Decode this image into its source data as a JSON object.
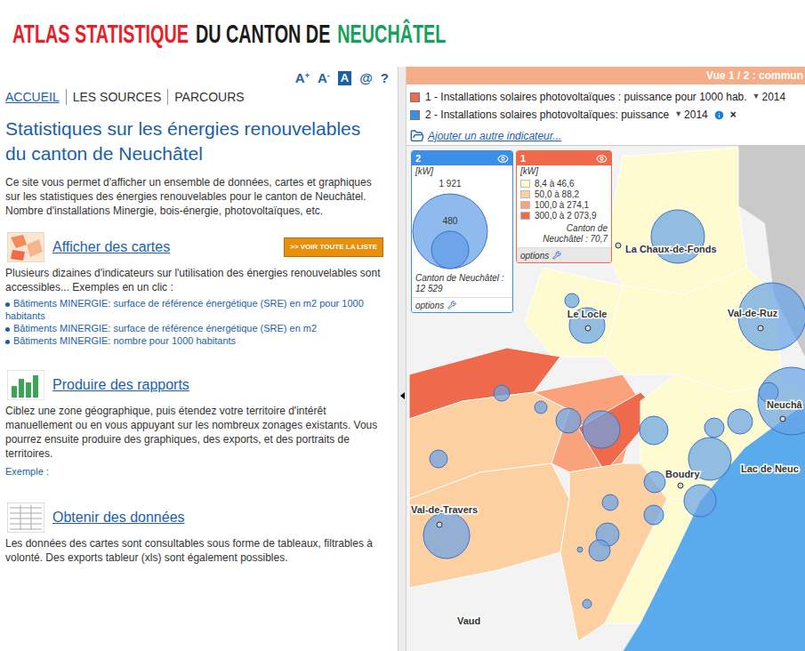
{
  "title": [
    {
      "text": "ATLAS STATISTIQUE",
      "color": "#e8202a"
    },
    {
      "text": "DU CANTON DE",
      "color": "#1a1a1a"
    },
    {
      "text": "NEUCHÂTEL",
      "color": "#16a05d"
    }
  ],
  "toolbar": [
    {
      "label": "A",
      "sup": "+",
      "kind": "plain"
    },
    {
      "label": "A",
      "sup": "-",
      "kind": "plain"
    },
    {
      "label": "A",
      "sup": "",
      "kind": "boxed"
    },
    {
      "label": "@",
      "sup": "",
      "kind": "plain"
    },
    {
      "label": "?",
      "sup": "",
      "kind": "plain"
    }
  ],
  "nav": [
    {
      "label": "ACCUEIL",
      "selected": true
    },
    {
      "label": "LES SOURCES",
      "selected": false
    },
    {
      "label": "PARCOURS",
      "selected": false
    }
  ],
  "heading": "Statistiques sur les énergies renouvelables du canton de Neuchâtel",
  "intro": "Ce site vous permet d'afficher un ensemble de données, cartes et graphiques sur les statistiques des énergies renouvelables pour le canton de Neuchâtel. Nombre d'installations Minergie, bois-énergie, photovoltaïques, etc.",
  "sections": [
    {
      "kind": "maps",
      "title": "Afficher des cartes",
      "button": ">> VOIR TOUTE LA LISTE",
      "text": "Plusieurs dizaines d'indicateurs sur l'utilisation des énergies renouvelables sont accessibles... Exemples en un clic :",
      "links": [
        "Bâtiments MINERGIE: surface de référence énergétique (SRE) en m2 pour 1000 habitants",
        "Bâtiments MINERGIE: surface de référence énergétique (SRE) en m2",
        "Bâtiments MINERGIE: nombre pour 1000 habitants"
      ]
    },
    {
      "kind": "reports",
      "title": "Produire des rapports",
      "text": "Ciblez une zone géographique, puis étendez votre territoire d'intérêt manuellement ou en vous appuyant sur les nombreux zonages existants. Vous pourrez ensuite produire des graphiques, des exports, et des portraits de territoires.",
      "example": "Exemple :"
    },
    {
      "kind": "data",
      "title": "Obtenir des données",
      "text": "Les données des cartes sont consultables sous forme de tableaux, filtrables à volonté. Des exports tableur (xls) sont également possibles."
    }
  ],
  "map": {
    "view": "Vue 1 / 2 : commun",
    "indicators": [
      {
        "label": "1 - Installations solaires photovoltaïques : puissance pour 1000 hab.",
        "arrow": "▼",
        "year": "2014",
        "color": "#ef6a4a",
        "info": false
      },
      {
        "label": "2 - Installations solaires photovoltaïques: puissance",
        "arrow": "▼",
        "year": "2014",
        "color": "#3b8fe6",
        "info": true,
        "close": "×"
      }
    ],
    "add_indicator": "Ajouter un autre indicateur...",
    "legend_circles": {
      "number": "2",
      "unit": "[kW]",
      "big": "1 921",
      "small": "480",
      "total_label": "Canton de Neuchâtel :",
      "total": "12 529",
      "options": "options",
      "color": "#3b8fe6"
    },
    "legend_classes": {
      "number": "1",
      "unit": "[kW]",
      "classes": [
        {
          "label": "8,4 à 46,6",
          "color": "#fffbd0"
        },
        {
          "label": "50,0 à 88,2",
          "color": "#fdd0a2"
        },
        {
          "label": "100,0 à 274,1",
          "color": "#f9a27c"
        },
        {
          "label": "300,0 à 2 073,9",
          "color": "#ef6a4a"
        }
      ],
      "total_label": "Canton de",
      "total": "Neuchâtel : 70,7",
      "options": "options",
      "color": "#ef6a4a"
    },
    "regions": [
      {
        "class": 0
      },
      {
        "class": 0
      },
      {
        "class": 0
      },
      {
        "class": 3
      },
      {
        "class": 1
      },
      {
        "class": 2
      },
      {
        "class": 3
      },
      {
        "class": 0
      },
      {
        "class": 1
      },
      {
        "class": 1
      },
      {
        "class": 0
      }
    ],
    "bubbles": [
      {
        "level": 0.75
      },
      {
        "level": 0.5
      },
      {
        "level": 0.95
      },
      {
        "level": 0.95
      },
      {
        "level": 0.2
      },
      {
        "level": 0.225
      },
      {
        "level": 0.175
      },
      {
        "level": 0.35
      },
      {
        "level": 0.525
      },
      {
        "level": 0.4
      },
      {
        "level": 0.275
      },
      {
        "level": 0.35
      },
      {
        "level": 0.275
      },
      {
        "level": 0.6
      },
      {
        "level": 0.3
      },
      {
        "level": 0.45
      },
      {
        "level": 0.275
      },
      {
        "level": 0.225
      },
      {
        "level": 0.325
      },
      {
        "level": 0.3
      },
      {
        "level": 0.25
      },
      {
        "level": 0.65
      },
      {
        "level": 0.125
      },
      {
        "level": 0.075
      }
    ],
    "places": [
      {
        "name": "La Chaux-de-Fonds",
        "marker": true
      },
      {
        "name": "Le Locle",
        "marker": true
      },
      {
        "name": "Val-de-Ruz",
        "marker": true
      },
      {
        "name": "Neuchâ",
        "marker": true
      },
      {
        "name": "Boudry",
        "marker": true
      },
      {
        "name": "Lac de Neuc",
        "marker": false
      },
      {
        "name": "Val-de-Travers",
        "marker": true
      },
      {
        "name": "Vaud",
        "marker": false
      }
    ]
  }
}
